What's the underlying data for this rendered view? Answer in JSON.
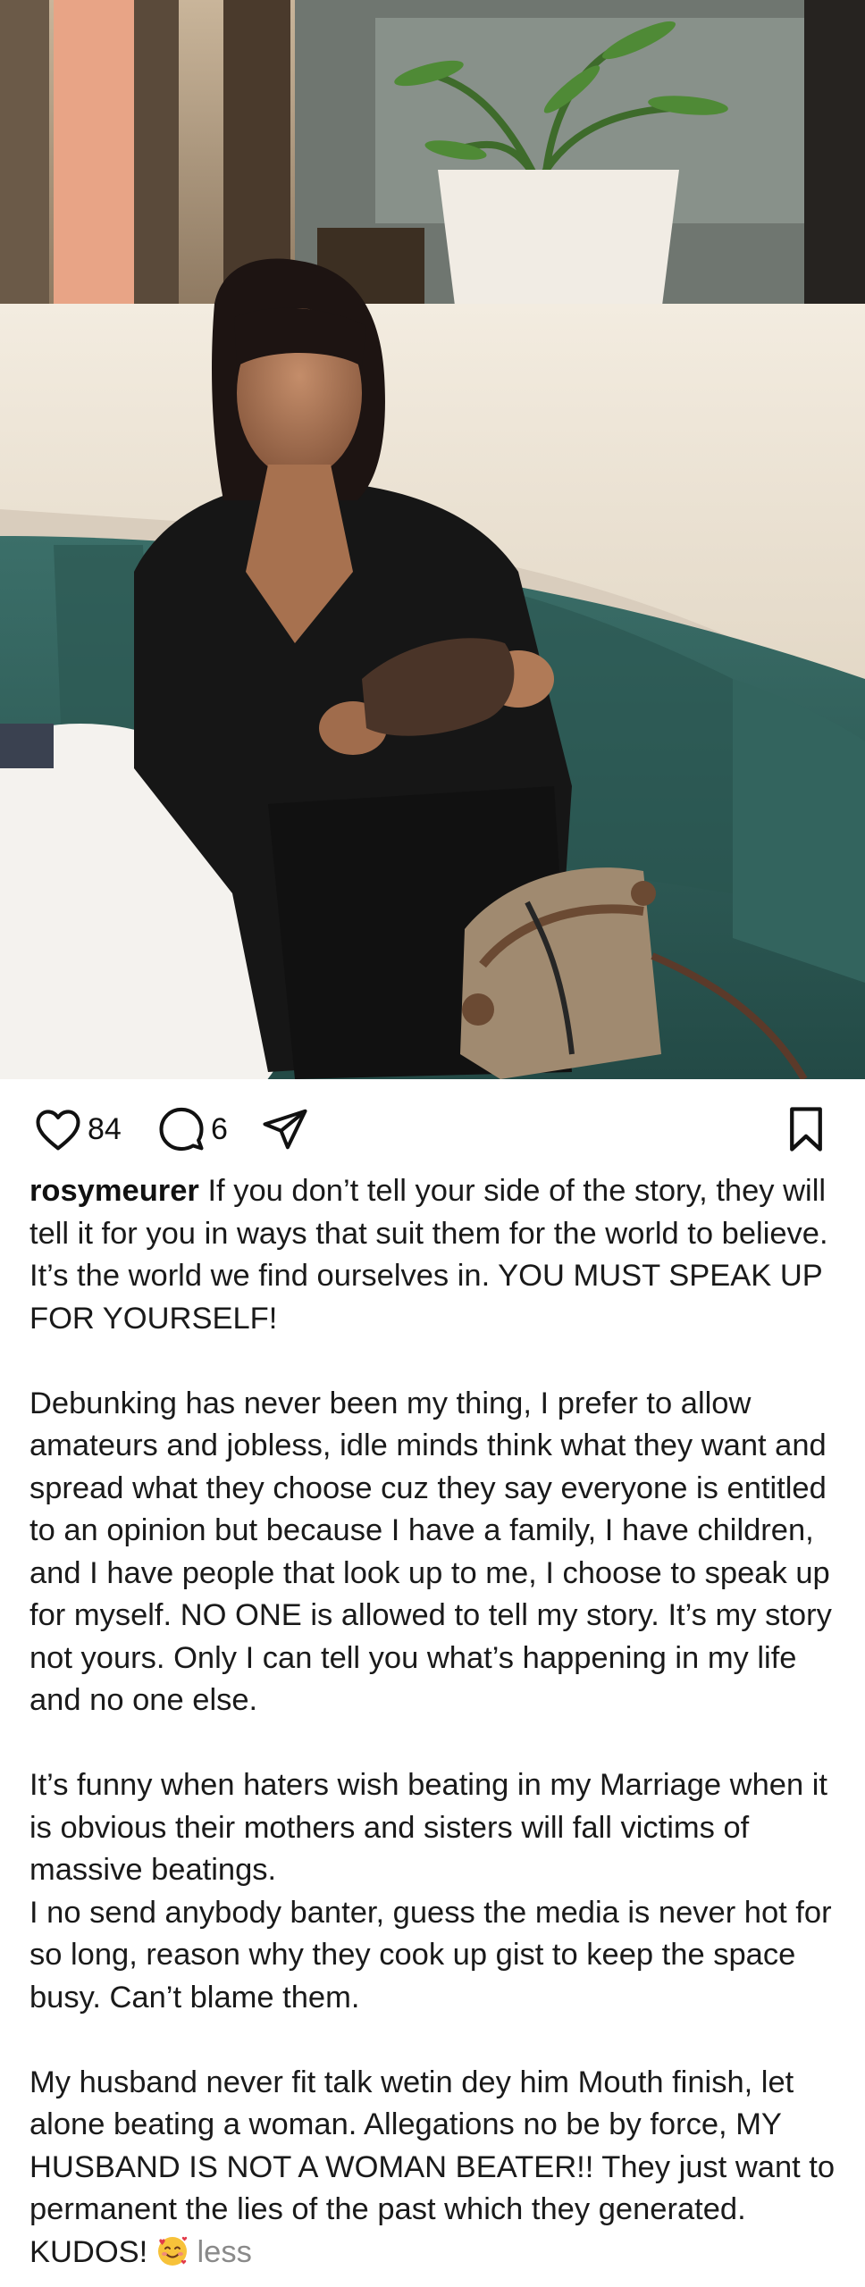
{
  "post": {
    "likes_count": "84",
    "comments_count": "6",
    "username": "rosymeurer",
    "paragraphs": [
      "If you don’t tell your side of the story, they will tell it for you in ways that suit them for the world to believe. It’s the world we find ourselves in. YOU MUST SPEAK UP FOR YOURSELF!",
      "Debunking has never been my thing, I prefer to allow amateurs and jobless, idle minds think what they want and spread what they choose cuz they say everyone is entitled to an opinion but because I have a family, I have children, and I have people that look up to me, I choose to speak up for myself. NO ONE is allowed to tell my story. It’s my story not yours. Only I can tell you what’s happening in my life and no one else.",
      "It’s funny when haters wish beating in my Marriage when it is obvious their mothers and sisters will fall victims of massive beatings.",
      "I no send anybody banter, guess the media is never hot for so long, reason why they cook up gist to keep the space busy. Can’t blame them.",
      "My husband never fit talk wetin dey him Mouth finish, let alone beating a woman. Allegations no be by force, MY HUSBAND IS NOT A WOMAN BEATER!! They just want to permanent the lies of the past which they generated. KUDOS!"
    ],
    "less_label": "less"
  },
  "icons": {
    "like": "heart-icon",
    "comment": "comment-bubble-icon",
    "share": "send-icon",
    "save": "bookmark-icon",
    "emoji": "smiling-face-with-hearts-icon"
  },
  "colors": {
    "text": "#1a1a1a",
    "muted": "#8a8a8a",
    "sofa": "#2f5c57",
    "wall": "#ece4d6"
  }
}
